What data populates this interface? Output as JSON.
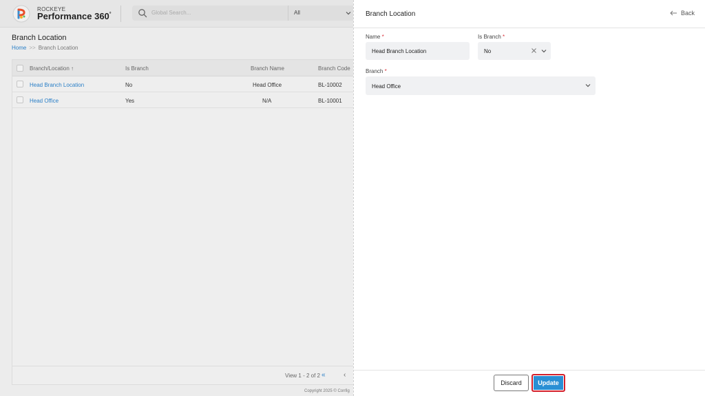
{
  "app": {
    "brand_top": "ROCKEYE",
    "brand_main": "Performance 360",
    "brand_mark": "°"
  },
  "search": {
    "placeholder": "Global Search...",
    "scope": "All"
  },
  "page": {
    "title": "Branch Location",
    "breadcrumb": {
      "home": "Home",
      "separator": ">>",
      "current": "Branch Location"
    }
  },
  "table": {
    "columns": [
      "Branch/Location ↑",
      "Is Branch",
      "Branch Name",
      "Branch Code"
    ],
    "rows": [
      {
        "name": "Head Branch Location",
        "is_branch": "No",
        "branch_name": "Head Office",
        "code": "BL-10002"
      },
      {
        "name": "Head Office",
        "is_branch": "Yes",
        "branch_name": "N/A",
        "code": "BL-10001"
      }
    ],
    "pager": {
      "view": "View 1 - 2 of 2",
      "first": "«",
      "prev": "‹"
    },
    "footer": "Copyright 2025 © Config"
  },
  "drawer": {
    "title": "Branch Location",
    "back_label": "Back",
    "fields": {
      "name": {
        "label": "Name",
        "required": "*",
        "value": "Head Branch Location"
      },
      "is_branch": {
        "label": "Is Branch",
        "required": "*",
        "value": "No"
      },
      "branch": {
        "label": "Branch",
        "required": "*",
        "value": "Head Office"
      }
    },
    "buttons": {
      "discard": "Discard",
      "update": "Update"
    }
  },
  "colors": {
    "accent": "#2a8fd4",
    "link": "#2a7fc7",
    "required": "#d9323a",
    "highlight": "#d41f2a"
  },
  "icons": [
    "logo-icon",
    "search-icon",
    "chevron-down-icon",
    "sort-arrow-icon",
    "back-arrow-icon",
    "clear-x-icon"
  ]
}
